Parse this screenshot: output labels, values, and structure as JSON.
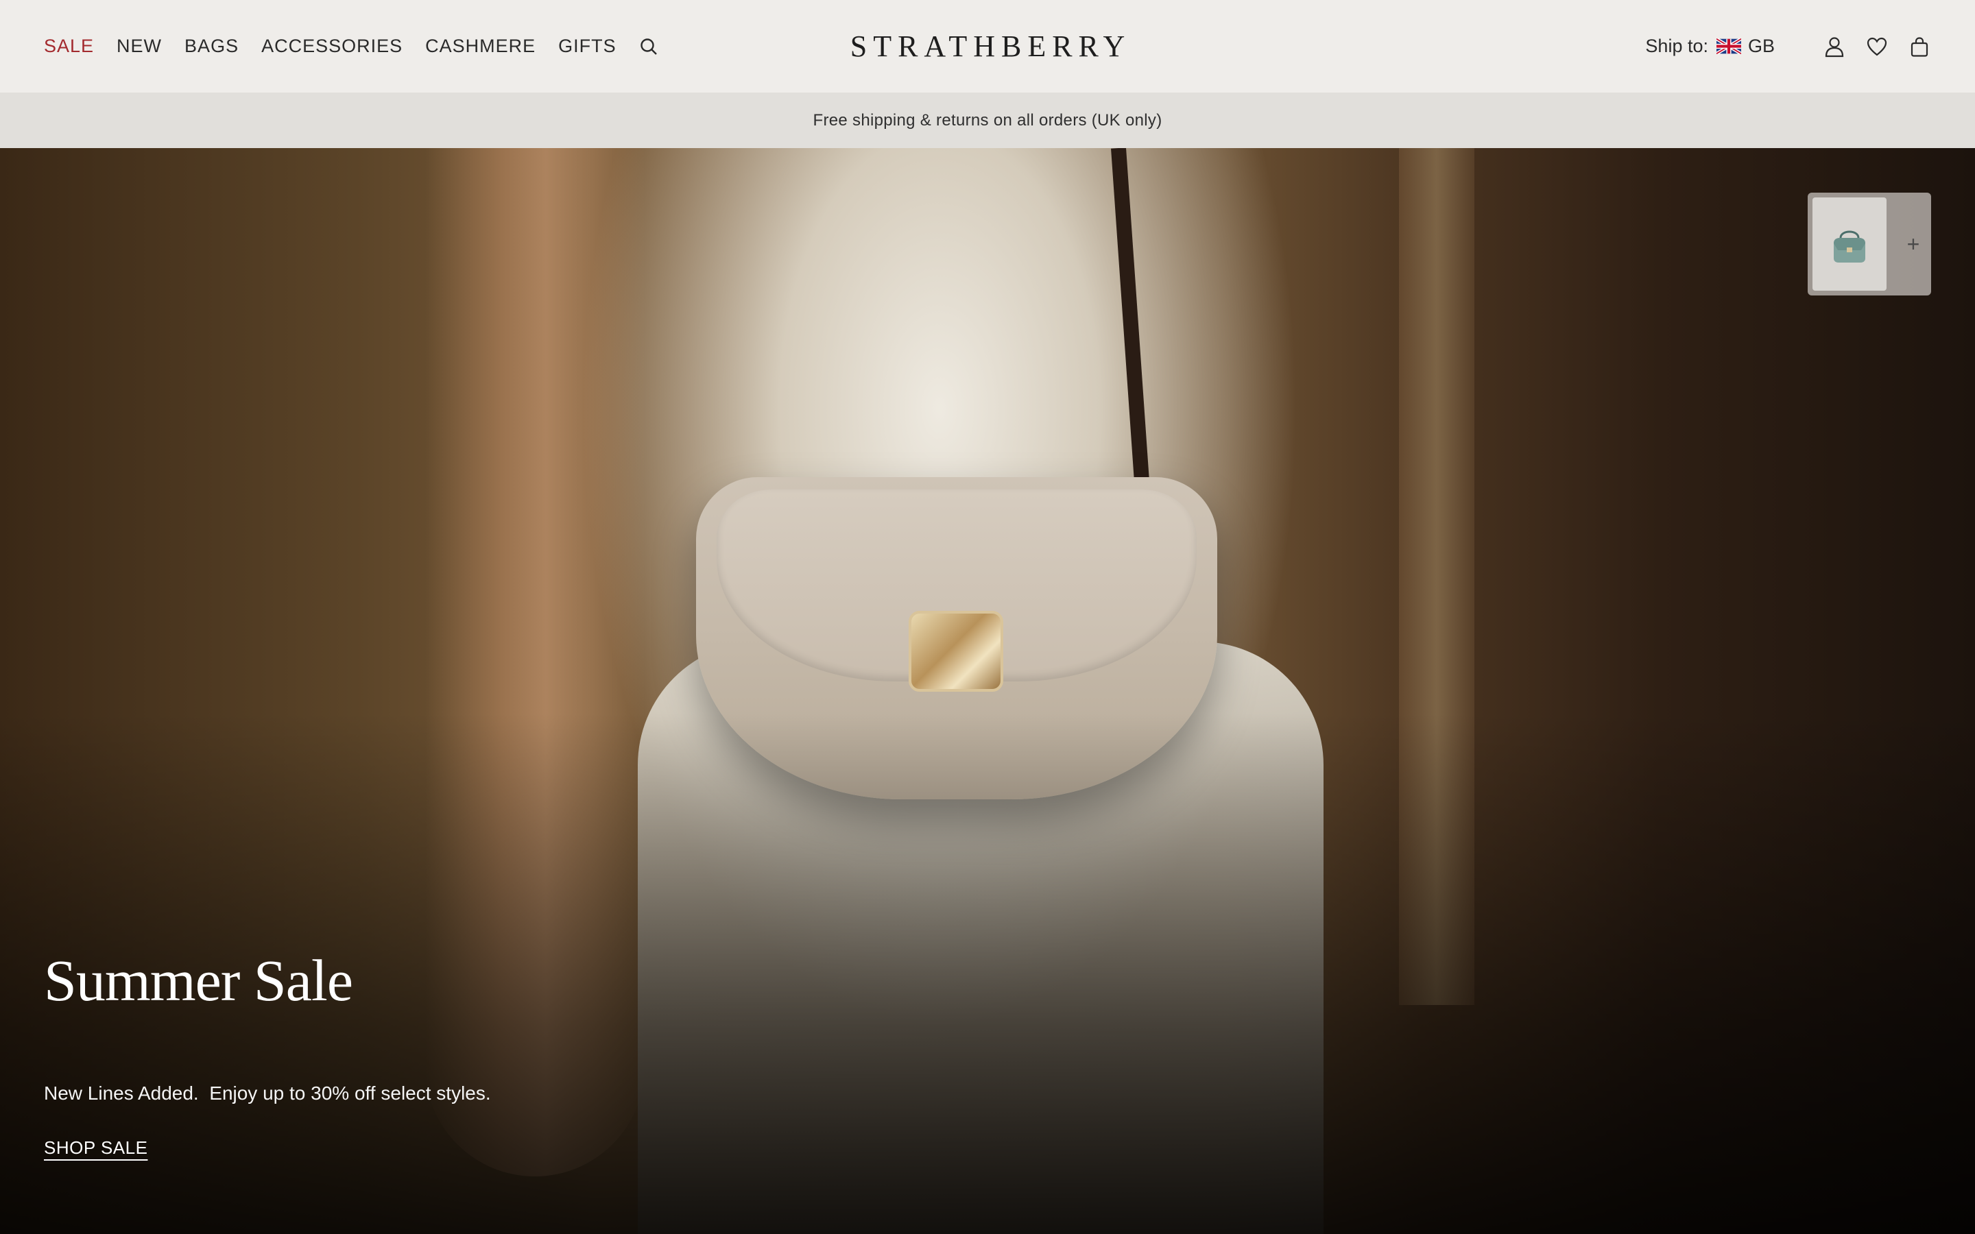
{
  "header": {
    "nav": [
      "SALE",
      "NEW",
      "BAGS",
      "ACCESSORIES",
      "CASHMERE",
      "GIFTS"
    ],
    "logo": "STRATHBERRY",
    "ship_label": "Ship to:",
    "ship_country": "GB",
    "icons": [
      "search-icon",
      "account-icon",
      "wishlist-heart-icon",
      "shopping-bag-icon"
    ]
  },
  "promo": {
    "text": "Free shipping & returns on all orders (UK only)"
  },
  "hero": {
    "title": "Summer Sale",
    "subtitle": "New Lines Added.  Enjoy up to 30% off select styles.",
    "cta": "SHOP SALE"
  },
  "widget": {
    "plus": "+"
  },
  "colors": {
    "header_bg": "#efedea",
    "promo_bg": "#e1dfdb",
    "sale_red": "#a32a2e",
    "text_dark": "#2a2a2a"
  }
}
